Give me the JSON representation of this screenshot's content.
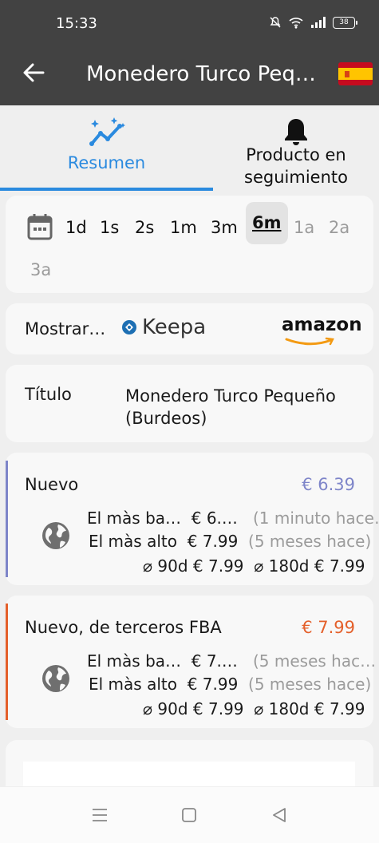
{
  "status_bar": {
    "time": "15:33",
    "battery": "38"
  },
  "app_bar": {
    "title": "Monedero Turco Pequeño (Burdeos)",
    "flag": "spain-flag"
  },
  "tabs": [
    {
      "label": "Resumen",
      "icon": "chart-sparkle-icon",
      "active": true
    },
    {
      "label": "Producto en seguimiento",
      "icon": "bell-icon",
      "active": false
    }
  ],
  "time_ranges": [
    {
      "label": "1d",
      "state": "enabled"
    },
    {
      "label": "1s",
      "state": "enabled"
    },
    {
      "label": "2s",
      "state": "enabled"
    },
    {
      "label": "1m",
      "state": "enabled"
    },
    {
      "label": "3m",
      "state": "enabled"
    },
    {
      "label": "6m",
      "state": "selected"
    },
    {
      "label": "1a",
      "state": "disabled"
    },
    {
      "label": "2a",
      "state": "disabled"
    },
    {
      "label": "3a",
      "state": "disabled"
    }
  ],
  "show": {
    "label": "Mostrar…",
    "keepa": "Keepa",
    "amazon": "amazon"
  },
  "product": {
    "title_label": "Título",
    "title_value": "Monedero Turco Pequeño (Burdeos)"
  },
  "prices": [
    {
      "name": "Nuevo",
      "current": "€ 6.39",
      "color": "#7e85c9",
      "lowest_label": "El màs ba…",
      "lowest_price": "€ 6.…",
      "lowest_when": "(1 minuto hace…",
      "highest_label": "El màs alto",
      "highest_price": "€ 7.99",
      "highest_when": "(5 meses hace)",
      "avg90": "⌀ 90d € 7.99",
      "avg180": "⌀ 180d € 7.99"
    },
    {
      "name": "Nuevo, de terceros FBA",
      "current": "€ 7.99",
      "color": "#e4602b",
      "lowest_label": "El màs ba…",
      "lowest_price": "€ 7.…",
      "lowest_when": "(5 meses hac…",
      "highest_label": "El màs alto",
      "highest_price": "€ 7.99",
      "highest_when": "(5 meses hace)",
      "avg90": "⌀ 90d € 7.99",
      "avg180": "⌀ 180d € 7.99"
    }
  ],
  "colors": {
    "accent": "#2a8adf",
    "app_bar": "#424242"
  }
}
